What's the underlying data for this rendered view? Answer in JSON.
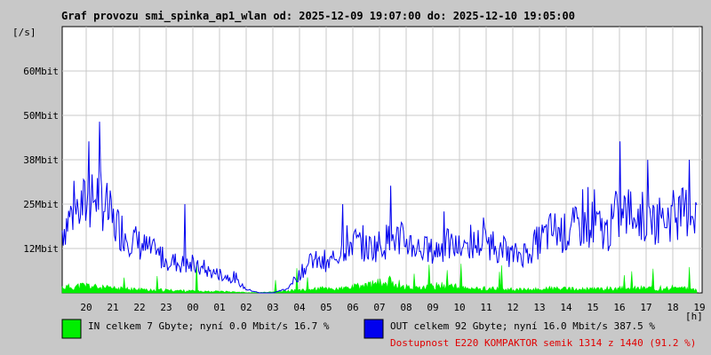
{
  "colors": {
    "background": "#c8c8c8",
    "plot": "#ffffff",
    "grid": "#c8c8c8",
    "in_series": "#00ee00",
    "out_series": "#0000ee",
    "availability": "#e00000"
  },
  "chart_data": {
    "type": "area",
    "title": "Graf provozu smi_spinka_ap1_wlan od: 2025-12-09 19:07:00 do: 2025-12-10 19:05:00",
    "ylabel": "[/s]",
    "xlabel": "[h]",
    "ylim": [
      0,
      72
    ],
    "grid": true,
    "y_ticks": [
      {
        "value": 12,
        "label": "12Mbit"
      },
      {
        "value": 24,
        "label": "25Mbit"
      },
      {
        "value": 36,
        "label": "38Mbit"
      },
      {
        "value": 48,
        "label": "50Mbit"
      },
      {
        "value": 60,
        "label": "60Mbit"
      }
    ],
    "x_ticks": [
      "20",
      "21",
      "22",
      "23",
      "00",
      "01",
      "02",
      "03",
      "04",
      "05",
      "06",
      "07",
      "08",
      "09",
      "10",
      "11",
      "12",
      "13",
      "14",
      "15",
      "16",
      "17",
      "18",
      "19"
    ],
    "x_range_hours": [
      19.1,
      43.1
    ],
    "series": [
      {
        "name": "IN",
        "style": "filled",
        "x": [
          19.1,
          19.5,
          20.0,
          20.5,
          21.0,
          21.5,
          22.0,
          22.5,
          23.0,
          23.5,
          24.0,
          24.5,
          25.0,
          25.5,
          26.0,
          26.5,
          27.0,
          27.5,
          28.0,
          28.5,
          29.0,
          29.5,
          30.0,
          30.5,
          31.0,
          31.5,
          32.0,
          32.5,
          33.0,
          33.5,
          34.0,
          34.5,
          35.0,
          35.5,
          36.0,
          36.5,
          37.0,
          37.5,
          38.0,
          38.5,
          39.0,
          39.5,
          40.0,
          40.5,
          41.0,
          41.5,
          42.0,
          42.5,
          43.0
        ],
        "values": [
          1.5,
          1.6,
          2.0,
          1.4,
          1.2,
          1.0,
          0.9,
          0.8,
          0.7,
          0.6,
          0.5,
          0.4,
          0.4,
          0.3,
          0.1,
          0.1,
          0.2,
          0.5,
          0.8,
          1.0,
          1.2,
          1.0,
          1.5,
          2.0,
          2.5,
          3.0,
          1.5,
          1.2,
          1.8,
          2.0,
          1.5,
          1.0,
          1.2,
          1.0,
          0.9,
          0.8,
          1.0,
          1.2,
          1.0,
          0.9,
          1.0,
          1.1,
          1.2,
          1.3,
          1.4,
          1.2,
          1.3,
          1.1,
          1.0
        ]
      },
      {
        "name": "OUT",
        "style": "line",
        "x": [
          19.1,
          19.5,
          20.0,
          20.5,
          21.0,
          21.5,
          22.0,
          22.5,
          23.0,
          23.5,
          24.0,
          24.5,
          25.0,
          25.5,
          26.0,
          26.5,
          27.0,
          27.5,
          28.0,
          28.5,
          29.0,
          29.5,
          30.0,
          30.5,
          31.0,
          31.5,
          32.0,
          32.5,
          33.0,
          33.5,
          34.0,
          34.5,
          35.0,
          35.5,
          36.0,
          36.5,
          37.0,
          37.5,
          38.0,
          38.5,
          39.0,
          39.5,
          40.0,
          40.5,
          41.0,
          41.5,
          42.0,
          42.5,
          43.0
        ],
        "values": [
          17,
          22,
          24,
          27,
          19,
          16,
          13,
          11,
          9,
          8,
          7,
          6,
          5,
          4,
          1,
          0,
          0,
          1,
          5,
          9,
          7,
          11,
          14,
          12,
          13,
          15,
          14,
          12,
          11,
          13,
          12,
          13,
          14,
          12,
          10,
          11,
          14,
          17,
          16,
          18,
          19,
          16,
          21,
          22,
          20,
          20,
          21,
          22,
          22
        ]
      }
    ],
    "peaks": [
      {
        "name": "OUT",
        "x": 20.1,
        "value": 41
      },
      {
        "name": "OUT",
        "x": 23.7,
        "value": 24
      },
      {
        "name": "OUT",
        "x": 29.6,
        "value": 24
      },
      {
        "name": "OUT",
        "x": 31.4,
        "value": 29
      },
      {
        "name": "OUT",
        "x": 33.4,
        "value": 22
      },
      {
        "name": "OUT",
        "x": 38.6,
        "value": 28
      },
      {
        "name": "OUT",
        "x": 40.0,
        "value": 41
      },
      {
        "name": "OUT",
        "x": 42.6,
        "value": 36
      }
    ]
  },
  "legend": {
    "in_text": "IN celkem 7 Gbyte; nyní   0.0 Mbit/s 16.7 %",
    "out_text": "OUT celkem 92 Gbyte; nyní  16.0 Mbit/s 387.5 %",
    "availability_text": "Dostupnost E220 KOMPAKTOR semik 1314 z 1440 (91.2 %)"
  }
}
